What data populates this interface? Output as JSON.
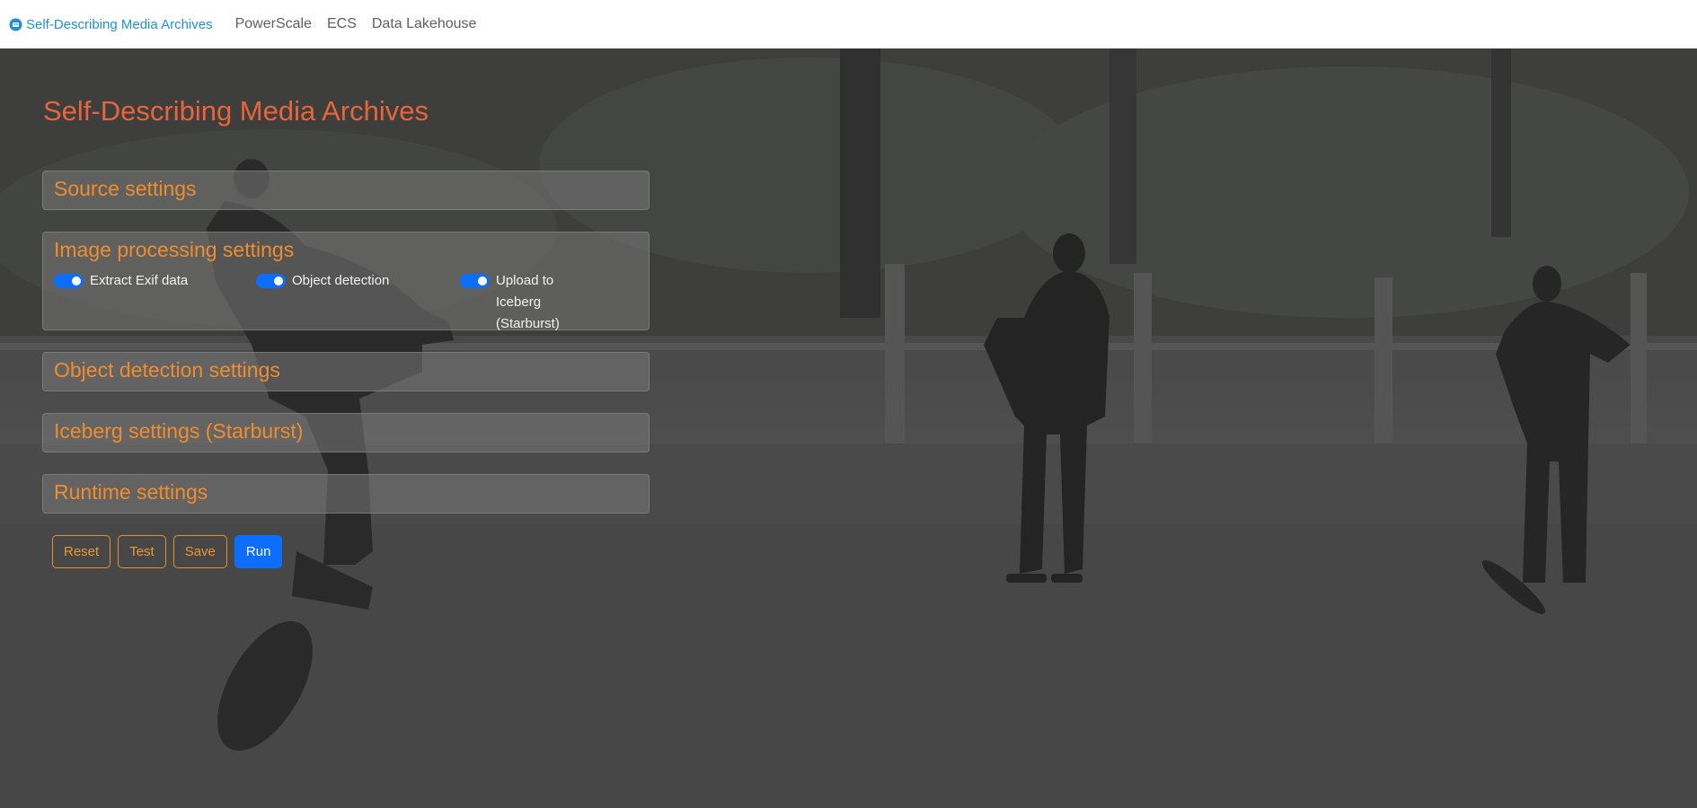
{
  "navbar": {
    "brand": "Self-Describing Media Archives",
    "links": [
      "PowerScale",
      "ECS",
      "Data Lakehouse"
    ]
  },
  "page": {
    "title": "Self-Describing Media Archives"
  },
  "panels": {
    "source": {
      "title": "Source settings"
    },
    "image_processing": {
      "title": "Image processing settings",
      "toggles": [
        {
          "label": "Extract Exif data",
          "checked": true
        },
        {
          "label": "Object detection",
          "checked": true
        },
        {
          "label": "Upload to Iceberg (Starburst)",
          "checked": true
        }
      ]
    },
    "object_detection": {
      "title": "Object detection settings"
    },
    "iceberg": {
      "title": "Iceberg settings (Starburst)"
    },
    "runtime": {
      "title": "Runtime settings"
    }
  },
  "buttons": {
    "reset": "Reset",
    "test": "Test",
    "save": "Save",
    "run": "Run"
  },
  "colors": {
    "brand": "#1e90d6",
    "title": "#e8643a",
    "panel_heading": "#ef8d2e",
    "primary": "#0d6efd"
  },
  "background": {
    "icon": "skateboarders-photo"
  }
}
